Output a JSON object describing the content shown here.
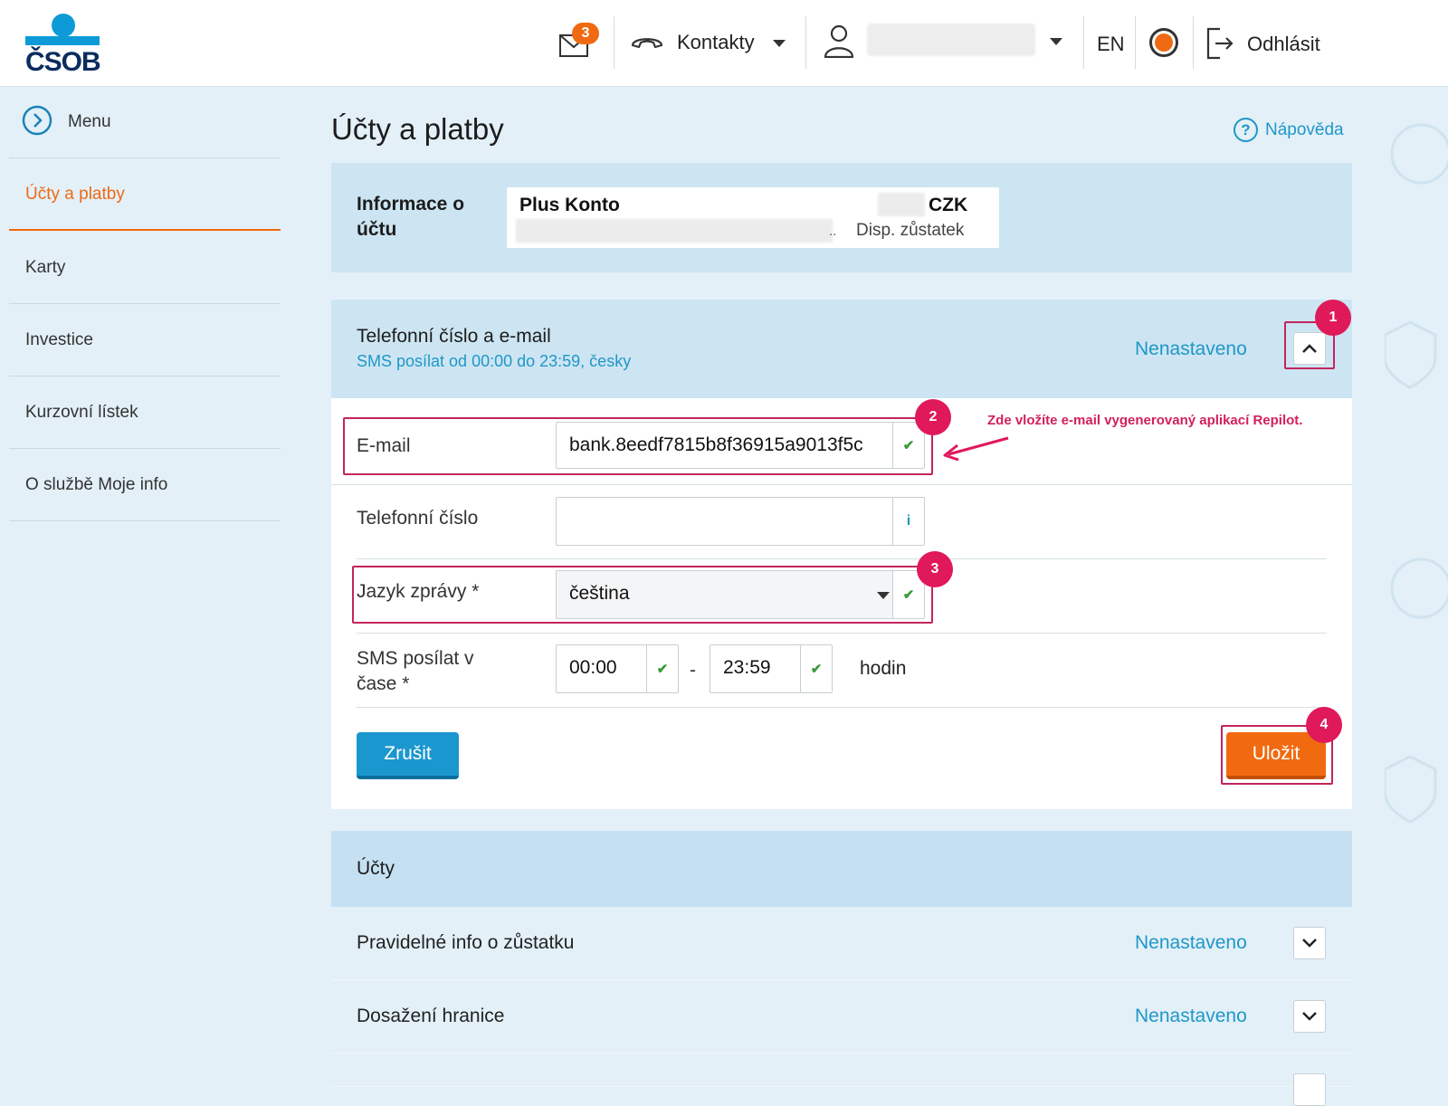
{
  "header": {
    "logo_text": "ČSOB",
    "mail_count": "3",
    "contacts_label": "Kontakty",
    "language_label": "EN",
    "logout_label": "Odhlásit"
  },
  "sidebar": {
    "menu_label": "Menu",
    "items": [
      {
        "label": "Účty a platby"
      },
      {
        "label": "Karty"
      },
      {
        "label": "Investice"
      },
      {
        "label": "Kurzovní lístek"
      },
      {
        "label": "O službě Moje info"
      }
    ]
  },
  "page": {
    "title": "Účty a platby",
    "help_label": "Nápověda"
  },
  "account_info": {
    "label": "Informace o účtu",
    "account_name": "Plus Konto",
    "currency": "CZK",
    "ellipsis": "..",
    "balance_label": "Disp. zůstatek"
  },
  "contact_section": {
    "title": "Telefonní číslo a e-mail",
    "subtitle": "SMS posílat od 00:00 do 23:59, česky",
    "status": "Nenastaveno",
    "email_label": "E-mail",
    "email_value": "bank.8eedf7815b8f36915a9013f5c",
    "phone_label": "Telefonní číslo",
    "phone_value": "",
    "phone_info": "i",
    "language_label": "Jazyk zprávy *",
    "language_value": "čeština",
    "sms_time_label": "SMS posílat v čase *",
    "time_from": "00:00",
    "time_dash": "-",
    "time_to": "23:59",
    "time_unit": "hodin",
    "cancel_label": "Zrušit",
    "save_label": "Uložit"
  },
  "annotations": {
    "badges": [
      "1",
      "2",
      "3",
      "4"
    ],
    "note": "Zde vložíte e-mail vygenerovaný aplikací Repilot."
  },
  "accounts_section": {
    "title": "Účty",
    "rows": [
      {
        "label": "Pravidelné info o zůstatku",
        "status": "Nenastaveno"
      },
      {
        "label": "Dosažení hranice",
        "status": "Nenastaveno"
      }
    ]
  },
  "colors": {
    "accent_orange": "#ef6a12",
    "link_blue": "#1f97c8",
    "cancel_blue": "#1b97cf",
    "annotation_pink": "#e0195a"
  }
}
